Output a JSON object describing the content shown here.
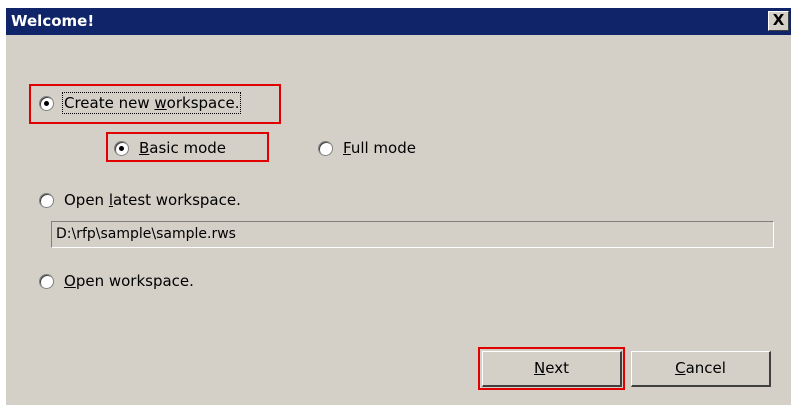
{
  "dialog": {
    "title": "Welcome!",
    "close_label": "X"
  },
  "options": {
    "create_new": {
      "label_first": "Create new ",
      "label_mnemonic": "w",
      "label_rest": "orkspace.",
      "checked": true
    },
    "basic_mode": {
      "label_mnemonic": "B",
      "label_rest": "asic mode",
      "checked": true
    },
    "full_mode": {
      "label_mnemonic": "F",
      "label_rest": "ull mode",
      "checked": false
    },
    "open_latest": {
      "label_first": "Open ",
      "label_mnemonic": "l",
      "label_rest": "atest workspace.",
      "checked": false
    },
    "open_workspace": {
      "label_mnemonic": "O",
      "label_rest": "pen workspace.",
      "checked": false
    }
  },
  "latest_path": {
    "value": "D:\\rfp\\sample\\sample.rws"
  },
  "buttons": {
    "next": {
      "mnemonic": "N",
      "rest": "ext"
    },
    "cancel": {
      "mnemonic": "C",
      "rest": "ancel"
    }
  },
  "colors": {
    "titlebar": "#10246a",
    "dialog_bg": "#d4d0c8",
    "highlight": "#e00000"
  }
}
